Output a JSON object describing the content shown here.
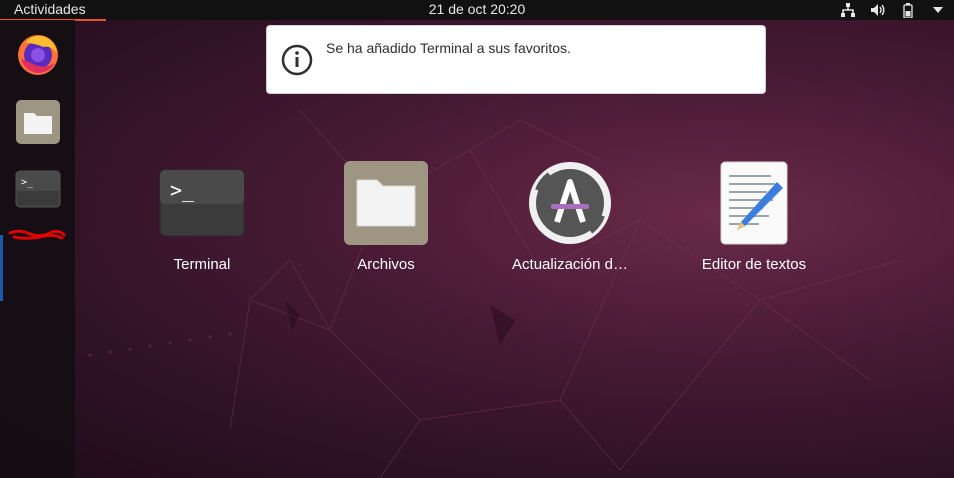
{
  "topbar": {
    "activities_label": "Actividades",
    "clock_text": "21 de oct  20:20",
    "tray": [
      "network-icon",
      "volume-icon",
      "battery-icon",
      "power-menu-icon"
    ]
  },
  "dock": {
    "items": [
      {
        "name": "firefox",
        "icon": "firefox-icon"
      },
      {
        "name": "files",
        "icon": "folder-icon"
      },
      {
        "name": "terminal",
        "icon": "terminal-icon"
      }
    ]
  },
  "notification": {
    "icon": "info-icon",
    "message": "Se ha añadido Terminal a sus favoritos."
  },
  "apps": [
    {
      "label": "Terminal",
      "icon": "terminal-icon"
    },
    {
      "label": "Archivos",
      "icon": "folder-icon"
    },
    {
      "label": "Actualización d…",
      "icon": "software-updater-icon"
    },
    {
      "label": "Editor de textos",
      "icon": "text-editor-icon"
    }
  ],
  "colors": {
    "accent": "#e95420",
    "topbar": "#111111",
    "background": "#4a1b36"
  }
}
